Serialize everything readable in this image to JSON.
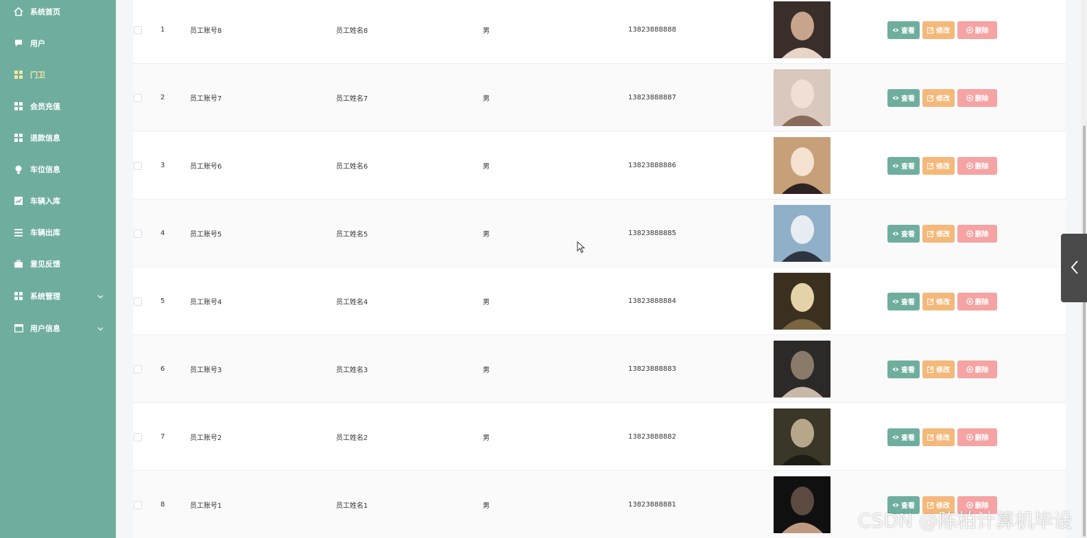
{
  "sidebar": {
    "items": [
      {
        "label": "系统首页",
        "icon": "home-icon"
      },
      {
        "label": "用户",
        "icon": "chat-icon"
      },
      {
        "label": "门卫",
        "icon": "grid-icon",
        "active": true
      },
      {
        "label": "会员充值",
        "icon": "grid-icon"
      },
      {
        "label": "退款信息",
        "icon": "grid-icon"
      },
      {
        "label": "车位信息",
        "icon": "bulb-icon"
      },
      {
        "label": "车辆入库",
        "icon": "chart-icon"
      },
      {
        "label": "车辆出库",
        "icon": "list-icon"
      },
      {
        "label": "意见反馈",
        "icon": "briefcase-icon"
      },
      {
        "label": "系统管理",
        "icon": "grid-icon",
        "expandable": true
      },
      {
        "label": "用户信息",
        "icon": "calendar-icon",
        "expandable": true
      }
    ]
  },
  "table": {
    "rows": [
      {
        "index": "1",
        "account": "员工账号8",
        "name": "员工姓名8",
        "gender": "男",
        "phone": "13823888888"
      },
      {
        "index": "2",
        "account": "员工账号7",
        "name": "员工姓名7",
        "gender": "男",
        "phone": "13823888887"
      },
      {
        "index": "3",
        "account": "员工账号6",
        "name": "员工姓名6",
        "gender": "男",
        "phone": "13823888886"
      },
      {
        "index": "4",
        "account": "员工账号5",
        "name": "员工姓名5",
        "gender": "男",
        "phone": "13823888885"
      },
      {
        "index": "5",
        "account": "员工账号4",
        "name": "员工姓名4",
        "gender": "男",
        "phone": "13823888884"
      },
      {
        "index": "6",
        "account": "员工账号3",
        "name": "员工姓名3",
        "gender": "男",
        "phone": "13823888883"
      },
      {
        "index": "7",
        "account": "员工账号2",
        "name": "员工姓名2",
        "gender": "男",
        "phone": "13823888882"
      },
      {
        "index": "8",
        "account": "员工账号1",
        "name": "员工姓名1",
        "gender": "男",
        "phone": "13823888881"
      }
    ],
    "actions": {
      "view": "查看",
      "edit": "修改",
      "delete": "删除"
    }
  },
  "watermark": "CSDN @陈柏计算机毕设",
  "colors": {
    "sidebar_bg": "#6fae9f",
    "view_button": "#6fae9f",
    "edit_button": "#f4b97a",
    "delete_button": "#f5a3a3",
    "active_menu_text": "#f7e6a6"
  }
}
